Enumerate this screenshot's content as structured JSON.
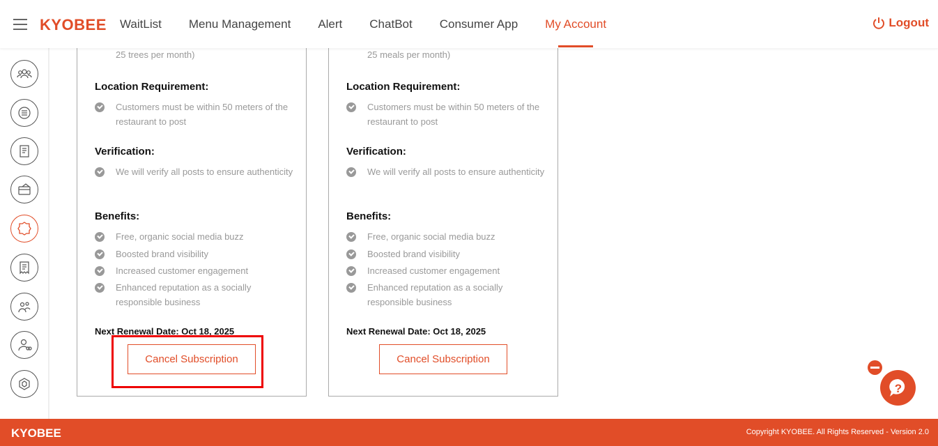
{
  "header": {
    "logo": "KYOBEE",
    "nav": [
      "WaitList",
      "Menu Management",
      "Alert",
      "ChatBot",
      "Consumer App",
      "My Account"
    ],
    "active_nav": "My Account",
    "logout": "Logout"
  },
  "sidebar": {
    "icons": [
      "group-icon",
      "chat-list-icon",
      "document-icon",
      "card-icon",
      "badge-icon",
      "receipt-icon",
      "people-icon",
      "user-link-icon",
      "hexagon-icon"
    ],
    "active_index": 4
  },
  "cards": [
    {
      "top_text": "25 trees per month)",
      "location_title": "Location Requirement:",
      "location_items": [
        "Customers must be within 50 meters of the restaurant to post"
      ],
      "verification_title": "Verification:",
      "verification_items": [
        "We will verify all posts to ensure authenticity"
      ],
      "benefits_title": "Benefits:",
      "benefits_items": [
        "Free, organic social media buzz",
        "Boosted brand visibility",
        "Increased customer engagement",
        "Enhanced reputation as a socially responsible business"
      ],
      "renewal": "Next Renewal Date: Oct 18, 2025",
      "cancel_label": "Cancel Subscription"
    },
    {
      "top_text": "25 meals per month)",
      "location_title": "Location Requirement:",
      "location_items": [
        "Customers must be within 50 meters of the restaurant to post"
      ],
      "verification_title": "Verification:",
      "verification_items": [
        "We will verify all posts to ensure authenticity"
      ],
      "benefits_title": "Benefits:",
      "benefits_items": [
        "Free, organic social media buzz",
        "Boosted brand visibility",
        "Increased customer engagement",
        "Enhanced reputation as a socially responsible business"
      ],
      "renewal": "Next Renewal Date: Oct 18, 2025",
      "cancel_label": "Cancel Subscription"
    }
  ],
  "footer": {
    "logo": "KYOBEE",
    "copyright": "Copyright KYOBEE. All Rights Reserved - Version 2.0"
  },
  "colors": {
    "accent": "#e14d28",
    "muted_text": "#999999",
    "highlight": "#ee0000"
  }
}
